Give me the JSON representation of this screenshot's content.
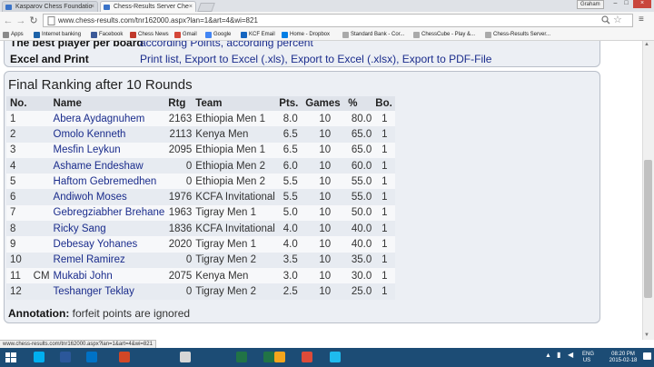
{
  "browser": {
    "tabs": [
      {
        "label": "Kasparov Chess Foundatio"
      },
      {
        "label": "Chess-Results Server Che"
      }
    ],
    "user_label": "Graham",
    "url": "www.chess-results.com/tnr162000.aspx?lan=1&art=4&wi=821",
    "bookmarks": [
      {
        "label": "Apps",
        "color": "#8a8a8a"
      },
      {
        "label": "Internet banking",
        "color": "#1e63a8"
      },
      {
        "label": "Facebook",
        "color": "#3b5998"
      },
      {
        "label": "Chess News",
        "color": "#c0392b"
      },
      {
        "label": "Gmail",
        "color": "#d44638"
      },
      {
        "label": "Google",
        "color": "#4285f4"
      },
      {
        "label": "KCF Email",
        "color": "#1565c0"
      },
      {
        "label": "Home - Dropbox",
        "color": "#007ee5"
      },
      {
        "label": "Standard Bank - Cor...",
        "color": "#aaaaaa"
      },
      {
        "label": "ChessCube - Play &...",
        "color": "#aaaaaa"
      },
      {
        "label": "Chess-Results Server...",
        "color": "#aaaaaa"
      }
    ],
    "status_url": "www.chess-results.com/tnr162000.aspx?lan=1&art=4&wi=821"
  },
  "page": {
    "best_player_label": "The best player per board",
    "best_player_links": [
      "according Points",
      "according percent"
    ],
    "excel_label": "Excel and Print",
    "excel_links": [
      "Print list",
      "Export to Excel (.xls)",
      "Export to Excel (.xlsx)",
      "Export to PDF-File"
    ],
    "ranking_title": "Final Ranking after 10 Rounds",
    "columns": {
      "no": "No.",
      "name": "Name",
      "rtg": "Rtg",
      "team": "Team",
      "pts": "Pts.",
      "games": "Games",
      "pct": "%",
      "bo": "Bo."
    },
    "rows": [
      {
        "no": "1",
        "title": "",
        "name": "Abera Aydagnuhem",
        "rtg": "2163",
        "team": "Ethiopia Men 1",
        "pts": "8.0",
        "games": "10",
        "pct": "80.0",
        "bo": "1"
      },
      {
        "no": "2",
        "title": "",
        "name": "Omolo Kenneth",
        "rtg": "2113",
        "team": "Kenya Men",
        "pts": "6.5",
        "games": "10",
        "pct": "65.0",
        "bo": "1"
      },
      {
        "no": "3",
        "title": "",
        "name": "Mesfin Leykun",
        "rtg": "2095",
        "team": "Ethiopia Men 1",
        "pts": "6.5",
        "games": "10",
        "pct": "65.0",
        "bo": "1"
      },
      {
        "no": "4",
        "title": "",
        "name": "Ashame Endeshaw",
        "rtg": "0",
        "team": "Ethiopia Men 2",
        "pts": "6.0",
        "games": "10",
        "pct": "60.0",
        "bo": "1"
      },
      {
        "no": "5",
        "title": "",
        "name": "Haftom Gebremedhen",
        "rtg": "0",
        "team": "Ethiopia Men 2",
        "pts": "5.5",
        "games": "10",
        "pct": "55.0",
        "bo": "1"
      },
      {
        "no": "6",
        "title": "",
        "name": "Andiwoh Moses",
        "rtg": "1976",
        "team": "KCFA Invitational",
        "pts": "5.5",
        "games": "10",
        "pct": "55.0",
        "bo": "1"
      },
      {
        "no": "7",
        "title": "",
        "name": "Gebregziabher Brehane",
        "rtg": "1963",
        "team": "Tigray Men 1",
        "pts": "5.0",
        "games": "10",
        "pct": "50.0",
        "bo": "1"
      },
      {
        "no": "8",
        "title": "",
        "name": "Ricky Sang",
        "rtg": "1836",
        "team": "KCFA Invitational",
        "pts": "4.0",
        "games": "10",
        "pct": "40.0",
        "bo": "1"
      },
      {
        "no": "9",
        "title": "",
        "name": "Debesay Yohanes",
        "rtg": "2020",
        "team": "Tigray Men 1",
        "pts": "4.0",
        "games": "10",
        "pct": "40.0",
        "bo": "1"
      },
      {
        "no": "10",
        "title": "",
        "name": "Remel Ramirez",
        "rtg": "0",
        "team": "Tigray Men 2",
        "pts": "3.5",
        "games": "10",
        "pct": "35.0",
        "bo": "1"
      },
      {
        "no": "11",
        "title": "CM",
        "name": "Mukabi John",
        "rtg": "2075",
        "team": "Kenya Men",
        "pts": "3.0",
        "games": "10",
        "pct": "30.0",
        "bo": "1"
      },
      {
        "no": "12",
        "title": "",
        "name": "Teshanger Teklay",
        "rtg": "0",
        "team": "Tigray Men 2",
        "pts": "2.5",
        "games": "10",
        "pct": "25.0",
        "bo": "1"
      }
    ],
    "annotation_label": "Annotation:",
    "annotation_text": "forfeit points are ignored"
  },
  "taskbar": {
    "apps": [
      {
        "icon": "skype-icon",
        "color": "#00aff0"
      },
      {
        "icon": "word-icon",
        "color": "#2b579a"
      },
      {
        "icon": "outlook-icon",
        "color": "#0072c6"
      },
      {
        "icon": "powerpoint-icon",
        "color": "#d24726"
      },
      {
        "icon": "calculator-icon",
        "color": "#d6d6d6"
      },
      {
        "icon": "excel-icon",
        "color": "#217346"
      },
      {
        "icon": "excel-2-icon",
        "color": "#217346"
      },
      {
        "icon": "app-13-icon",
        "color": "#f4a51c"
      },
      {
        "icon": "chrome-icon",
        "color": "#dd4b39"
      },
      {
        "icon": "internet-explorer-icon",
        "color": "#1ebbee"
      }
    ],
    "language": "ENG",
    "region": "US",
    "time": "08:20 PM",
    "date": "2015-02-18"
  }
}
